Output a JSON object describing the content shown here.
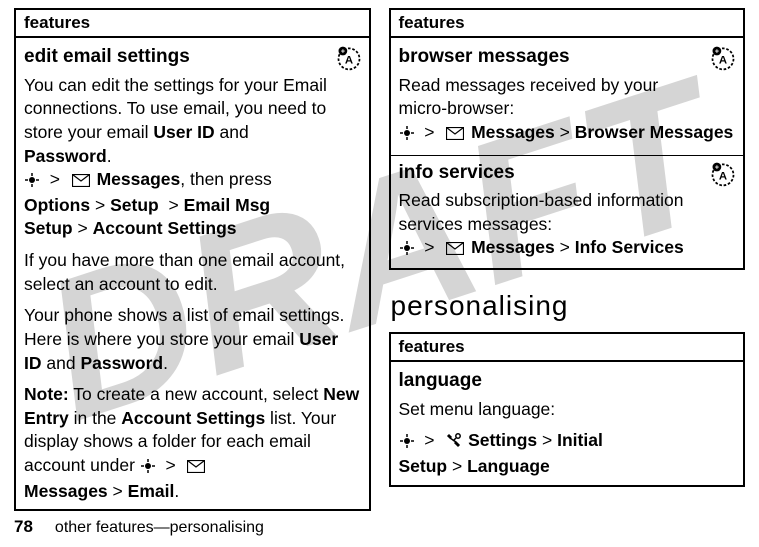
{
  "watermark": "DRAFT",
  "left": {
    "header": "features",
    "edit_email": {
      "title": "edit email settings",
      "p1a": "You can edit the settings for your Email connections. To use email, you need to store your email ",
      "p1_uid": "User ID",
      "p1_and": " and ",
      "p1_pw": "Password",
      "p1_end": ".",
      "nav1_msgs": "Messages",
      "nav1_then": ", then press ",
      "nav1_opts": "Options",
      "nav1_setup": "Setup",
      "nav1_ems": "Email Msg Setup",
      "nav1_as": "Account Settings",
      "p2": "If you have more than one email account, select an account to edit.",
      "p3a": "Your phone shows a list of email settings. Here is where you store your email ",
      "p3_uid": "User ID",
      "p3_and": " and ",
      "p3_pw": "Password",
      "p3_end": ".",
      "note_label": "Note:",
      "note_a": " To create a new account, select ",
      "note_ne": "New Entry",
      "note_b": " in the ",
      "note_as": "Account Settings",
      "note_c": " list. Your display shows a folder for each email account under ",
      "note_msgs": "Messages",
      "note_email": "Email",
      "note_end": "."
    }
  },
  "right": {
    "header": "features",
    "browser": {
      "title": "browser messages",
      "p1": "Read messages received by your micro-browser:",
      "nav_msgs": "Messages",
      "nav_bm": "Browser Messages"
    },
    "info": {
      "title": "info services",
      "p1": "Read subscription-based information services messages:",
      "nav_msgs": "Messages",
      "nav_is": "Info Services"
    },
    "section": "personalising",
    "lang_box": {
      "header": "features",
      "title": "language",
      "p1": "Set menu language:",
      "nav_set": "Settings",
      "nav_init": "Initial Setup",
      "nav_lang": "Language"
    }
  },
  "footer": {
    "page": "78",
    "text": "other features—personalising"
  },
  "glyphs": {
    "gt": ">"
  }
}
